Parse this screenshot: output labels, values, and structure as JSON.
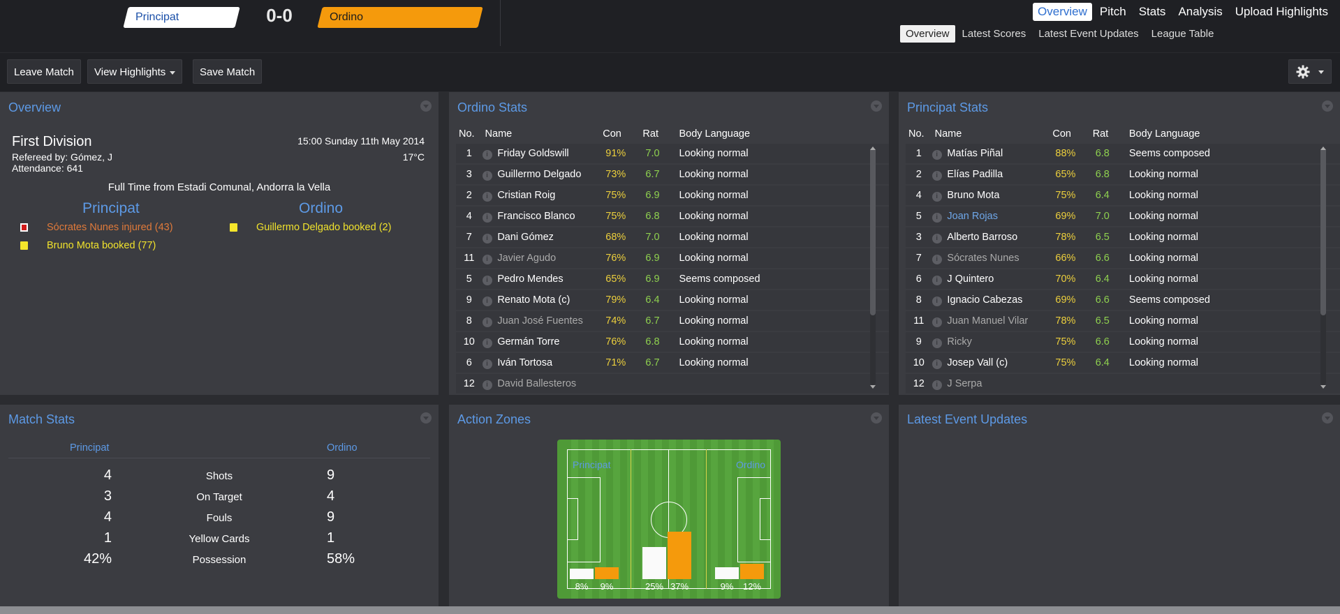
{
  "header": {
    "home_team": "Principat",
    "away_team": "Ordino",
    "score": "0-0",
    "colors": {
      "home": "#ffffff",
      "away": "#f59a0c",
      "accent": "#5d9ae6"
    }
  },
  "nav": {
    "primary": [
      "Overview",
      "Pitch",
      "Stats",
      "Analysis",
      "Upload Highlights"
    ],
    "secondary": [
      "Overview",
      "Latest Scores",
      "Latest Event Updates",
      "League Table"
    ]
  },
  "toolbar": {
    "leave": "Leave Match",
    "highlights": "View Highlights",
    "save": "Save Match",
    "settings_icon": "gear-icon"
  },
  "overview": {
    "title": "Overview",
    "competition": "First Division",
    "referee": "Refereed by: Gómez, J",
    "attendance": "Attendance: 641",
    "datetime": "15:00 Sunday 11th May 2014",
    "temperature": "17°C",
    "status": "Full Time from Estadi Comunal, Andorra la Vella",
    "home": "Principat",
    "away": "Ordino",
    "home_events": [
      {
        "text": "Sócrates Nunes injured (43)",
        "icon": "injury-icon",
        "color": "#e07a3a"
      },
      {
        "text": "Bruno Mota booked (77)",
        "icon": "yellow-card-icon",
        "color": "#f0e22c"
      }
    ],
    "away_events": [
      {
        "text": "Guillermo Delgado booked (2)",
        "icon": "yellow-card-icon",
        "color": "#f0e22c"
      }
    ]
  },
  "columns": [
    "No.",
    "Name",
    "Con",
    "Rat",
    "Body Language"
  ],
  "ordino_stats": {
    "title": "Ordino Stats",
    "rows": [
      {
        "no": "1",
        "name": "Friday Goldswill",
        "con": "91%",
        "rat": "7.0",
        "bl": "Looking normal",
        "style": ""
      },
      {
        "no": "3",
        "name": "Guillermo Delgado",
        "con": "73%",
        "rat": "6.7",
        "bl": "Looking normal",
        "style": ""
      },
      {
        "no": "2",
        "name": "Cristian Roig",
        "con": "75%",
        "rat": "6.9",
        "bl": "Looking normal",
        "style": ""
      },
      {
        "no": "4",
        "name": "Francisco Blanco",
        "con": "75%",
        "rat": "6.8",
        "bl": "Looking normal",
        "style": ""
      },
      {
        "no": "7",
        "name": "Dani Gómez",
        "con": "68%",
        "rat": "7.0",
        "bl": "Looking normal",
        "style": ""
      },
      {
        "no": "11",
        "name": "Javier Agudo",
        "con": "76%",
        "rat": "6.9",
        "bl": "Looking normal",
        "style": "dim"
      },
      {
        "no": "5",
        "name": "Pedro Mendes",
        "con": "65%",
        "rat": "6.9",
        "bl": "Seems composed",
        "style": ""
      },
      {
        "no": "9",
        "name": "Renato Mota (c)",
        "con": "79%",
        "rat": "6.4",
        "bl": "Looking normal",
        "style": ""
      },
      {
        "no": "8",
        "name": "Juan José Fuentes",
        "con": "74%",
        "rat": "6.7",
        "bl": "Looking normal",
        "style": "dim"
      },
      {
        "no": "10",
        "name": "Germán Torre",
        "con": "76%",
        "rat": "6.8",
        "bl": "Looking normal",
        "style": ""
      },
      {
        "no": "6",
        "name": "Iván Tortosa",
        "con": "71%",
        "rat": "6.7",
        "bl": "Looking normal",
        "style": ""
      },
      {
        "no": "12",
        "name": "David Ballesteros",
        "con": "",
        "rat": "",
        "bl": "",
        "style": "dim"
      }
    ]
  },
  "principat_stats": {
    "title": "Principat Stats",
    "rows": [
      {
        "no": "1",
        "name": "Matías Piñal",
        "con": "88%",
        "rat": "6.8",
        "bl": "Seems composed",
        "style": ""
      },
      {
        "no": "2",
        "name": "Elías Padilla",
        "con": "65%",
        "rat": "6.8",
        "bl": "Looking normal",
        "style": ""
      },
      {
        "no": "4",
        "name": "Bruno Mota",
        "con": "75%",
        "rat": "6.4",
        "bl": "Looking normal",
        "style": ""
      },
      {
        "no": "5",
        "name": "Joan Rojas",
        "con": "69%",
        "rat": "7.0",
        "bl": "Looking normal",
        "style": "link"
      },
      {
        "no": "3",
        "name": "Alberto Barroso",
        "con": "78%",
        "rat": "6.5",
        "bl": "Looking normal",
        "style": ""
      },
      {
        "no": "7",
        "name": "Sócrates Nunes",
        "con": "66%",
        "rat": "6.6",
        "bl": "Looking normal",
        "style": "dim"
      },
      {
        "no": "6",
        "name": "J Quintero",
        "con": "70%",
        "rat": "6.4",
        "bl": "Looking normal",
        "style": ""
      },
      {
        "no": "8",
        "name": "Ignacio Cabezas",
        "con": "69%",
        "rat": "6.6",
        "bl": "Seems composed",
        "style": ""
      },
      {
        "no": "11",
        "name": "Juan Manuel Vilar",
        "con": "78%",
        "rat": "6.5",
        "bl": "Looking normal",
        "style": "dim"
      },
      {
        "no": "9",
        "name": "Ricky",
        "con": "75%",
        "rat": "6.6",
        "bl": "Looking normal",
        "style": "dim"
      },
      {
        "no": "10",
        "name": "Josep Vall (c)",
        "con": "75%",
        "rat": "6.4",
        "bl": "Looking normal",
        "style": ""
      },
      {
        "no": "12",
        "name": "J Serpa",
        "con": "",
        "rat": "",
        "bl": "",
        "style": "dim"
      }
    ]
  },
  "match_stats": {
    "title": "Match Stats",
    "home": "Principat",
    "away": "Ordino",
    "rows": [
      {
        "label": "Shots",
        "home": "4",
        "away": "9"
      },
      {
        "label": "On Target",
        "home": "3",
        "away": "4"
      },
      {
        "label": "Fouls",
        "home": "4",
        "away": "9"
      },
      {
        "label": "Yellow Cards",
        "home": "1",
        "away": "1"
      },
      {
        "label": "Possession",
        "home": "42%",
        "away": "58%"
      }
    ]
  },
  "action_zones": {
    "title": "Action Zones",
    "home": "Principat",
    "away": "Ordino",
    "zones": [
      {
        "home": 8,
        "away": 9,
        "home_label": "8%",
        "away_label": "9%"
      },
      {
        "home": 25,
        "away": 37,
        "home_label": "25%",
        "away_label": "37%"
      },
      {
        "home": 9,
        "away": 12,
        "home_label": "9%",
        "away_label": "12%"
      }
    ]
  },
  "latest_events": {
    "title": "Latest Event Updates"
  }
}
